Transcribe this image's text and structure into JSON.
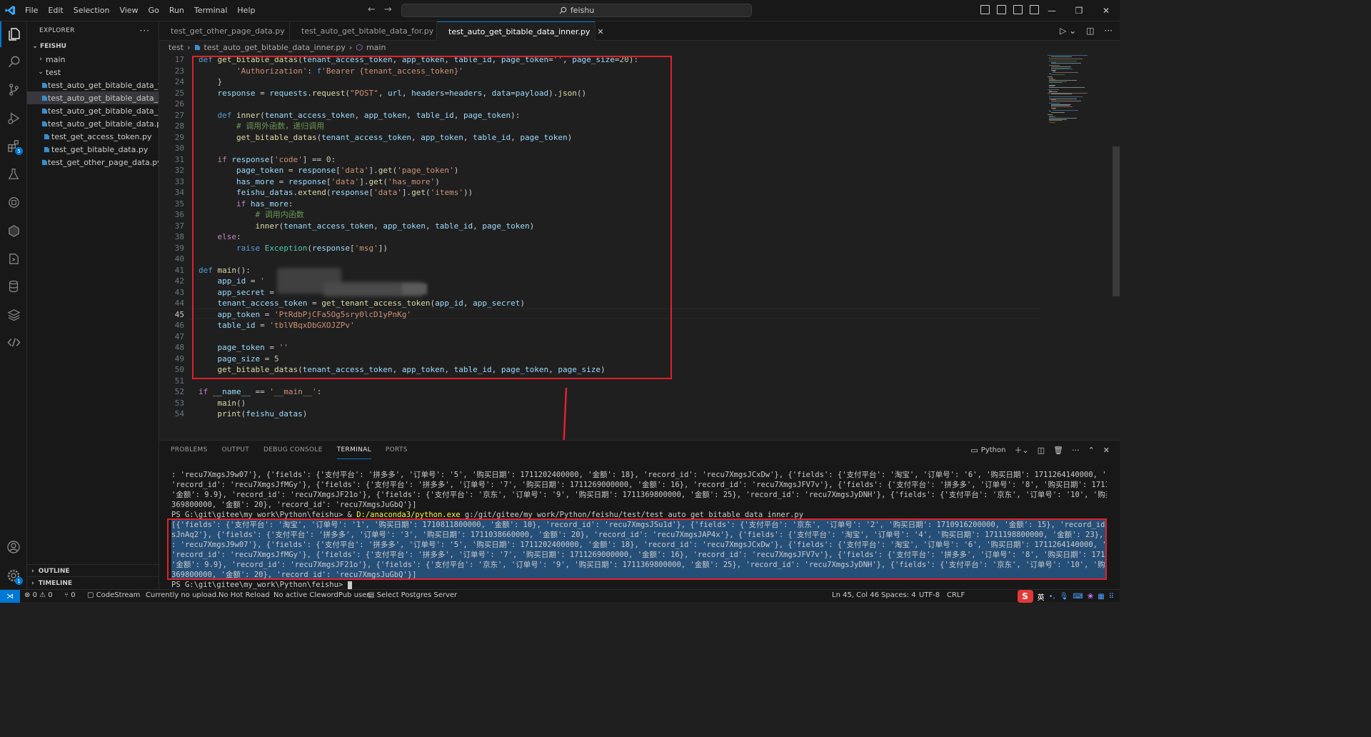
{
  "menu": [
    "File",
    "Edit",
    "Selection",
    "View",
    "Go",
    "Run",
    "Terminal",
    "Help"
  ],
  "search": {
    "text": "feishu"
  },
  "sidebar": {
    "title": "EXPLORER",
    "root": "FEISHU",
    "folders": [
      "main",
      "test"
    ],
    "files": [
      "test_auto_get_bitable_data_fo...",
      "test_auto_get_bitable_data_in...",
      "test_auto_get_bitable_data_w...",
      "test_auto_get_bitable_data.py",
      "test_get_access_token.py",
      "test_get_bitable_data.py",
      "test_get_other_page_data.py"
    ],
    "outline": "OUTLINE",
    "timeline": "TIMELINE"
  },
  "activity_badges": {
    "extensions": "5",
    "settings": "1"
  },
  "tabs": [
    {
      "label": "test_get_other_page_data.py"
    },
    {
      "label": "test_auto_get_bitable_data_for.py"
    },
    {
      "label": "test_auto_get_bitable_data_inner.py"
    }
  ],
  "breadcrumb": {
    "folder": "test",
    "file": "test_auto_get_bitable_data_inner.py",
    "symbol": "main"
  },
  "code": [
    {
      "n": "17",
      "t": "def get_bitable_datas(tenant_access_token, app_token, table_id, page_token='', page_size=20):"
    },
    {
      "n": "23",
      "t": "        'Authorization': f'Bearer {tenant_access_token}'"
    },
    {
      "n": "24",
      "t": "    }"
    },
    {
      "n": "25",
      "t": "    response = requests.request(\"POST\", url, headers=headers, data=payload).json()"
    },
    {
      "n": "26",
      "t": ""
    },
    {
      "n": "27",
      "t": "    def inner(tenant_access_token, app_token, table_id, page_token):"
    },
    {
      "n": "28",
      "t": "        # 调用外函数，递归调用"
    },
    {
      "n": "29",
      "t": "        get_bitable_datas(tenant_access_token, app_token, table_id, page_token)"
    },
    {
      "n": "30",
      "t": ""
    },
    {
      "n": "31",
      "t": "    if response['code'] == 0:"
    },
    {
      "n": "32",
      "t": "        page_token = response['data'].get('page_token')"
    },
    {
      "n": "33",
      "t": "        has_more = response['data'].get('has_more')"
    },
    {
      "n": "34",
      "t": "        feishu_datas.extend(response['data'].get('items'))"
    },
    {
      "n": "35",
      "t": "        if has_more:"
    },
    {
      "n": "36",
      "t": "            # 调用内函数"
    },
    {
      "n": "37",
      "t": "            inner(tenant_access_token, app_token, table_id, page_token)"
    },
    {
      "n": "38",
      "t": "    else:"
    },
    {
      "n": "39",
      "t": "        raise Exception(response['msg'])"
    },
    {
      "n": "40",
      "t": ""
    },
    {
      "n": "41",
      "t": "def main():"
    },
    {
      "n": "42",
      "t": "    app_id = '"
    },
    {
      "n": "43",
      "t": "    app_secret = '"
    },
    {
      "n": "44",
      "t": "    tenant_access_token = get_tenant_access_token(app_id, app_secret)"
    },
    {
      "n": "45",
      "t": "    app_token = 'PtRdbPjCFa5Og5sry0lcD1yPnKg'"
    },
    {
      "n": "46",
      "t": "    table_id = 'tblVBqxDbGXOJZPv'"
    },
    {
      "n": "47",
      "t": ""
    },
    {
      "n": "48",
      "t": "    page_token = ''"
    },
    {
      "n": "49",
      "t": "    page_size = 5"
    },
    {
      "n": "50",
      "t": "    get_bitable_datas(tenant_access_token, app_token, table_id, page_token, page_size)"
    },
    {
      "n": "51",
      "t": ""
    },
    {
      "n": "52",
      "t": "if __name__ == '__main__':"
    },
    {
      "n": "53",
      "t": "    main()"
    },
    {
      "n": "54",
      "t": "    print(feishu_datas)"
    }
  ],
  "panel": {
    "tabs": [
      "PROBLEMS",
      "OUTPUT",
      "DEBUG CONSOLE",
      "TERMINAL",
      "PORTS"
    ],
    "shell": "Python"
  },
  "terminal": [
    ": 'recu7XmgsJ9w07'}, {'fields': {'支付平台': '拼多多', '订单号': '5', '购买日期': 1711202400000, '金额': 18}, 'record_id': 'recu7XmgsJCxDw'}, {'fields': {'支付平台': '淘宝', '订单号': '6', '购买日期': 1711264140000, '金额': 20},",
    "'record_id': 'recu7XmgsJfMGy'}, {'fields': {'支付平台': '拼多多', '订单号': '7', '购买日期': 1711269000000, '金额': 16}, 'record_id': 'recu7XmgsJFV7v'}, {'fields': {'支付平台': '拼多多', '订单号': '8', '购买日期': 1711362600000,",
    "'金额': 9.9}, 'record_id': 'recu7XmgsJF21o'}, {'fields': {'支付平台': '京东', '订单号': '9', '购买日期': 1711369800000, '金额': 25}, 'record_id': 'recu7XmgsJyDNH'}, {'fields': {'支付平台': '京东', '订单号': '10', '购买日期': 1711",
    "369800000, '金额': 20}, 'record_id': 'recu7XmgsJuGbQ'}]",
    "PS G:\\git\\gitee\\my_work\\Python\\feishu> & D:/anaconda3/python.exe g:/git/gitee/my_work/Python/feishu/test/test_auto_get_bitable_data_inner.py",
    "[{'fields': {'支付平台': '淘宝', '订单号': '1', '购买日期': 1710811800000, '金额': 10}, 'record_id': 'recu7XmgsJSu1d'}, {'fields': {'支付平台': '京东', '订单号': '2', '购买日期': 1710916200000, '金额': 15}, 'record_id': 'recu7Xmg",
    "sJnAq2'}, {'fields': {'支付平台': '拼多多', '订单号': '3', '购买日期': 1711038660000, '金额': 20}, 'record_id': 'recu7XmgsJAP4x'}, {'fields': {'支付平台': '淘宝', '订单号': '4', '购买日期': 1711198800000, '金额': 23}, 'record_id'",
    ": 'recu7XmgsJ9w07'}, {'fields': {'支付平台': '拼多多', '订单号': '5', '购买日期': 1711202400000, '金额': 18}, 'record_id': 'recu7XmgsJCxDw'}, {'fields': {'支付平台': '淘宝', '订单号': '6', '购买日期': 1711264140000, '金额': 20},",
    "'record_id': 'recu7XmgsJfMGy'}, {'fields': {'支付平台': '拼多多', '订单号': '7', '购买日期': 1711269000000, '金额': 16}, 'record_id': 'recu7XmgsJFV7v'}, {'fields': {'支付平台': '拼多多', '订单号': '8', '购买日期': 1711362600000,",
    "'金额': 9.9}, 'record_id': 'recu7XmgsJF21o'}, {'fields': {'支付平台': '京东', '订单号': '9', '购买日期': 1711369800000, '金额': 25}, 'record_id': 'recu7XmgsJyDNH'}, {'fields': {'支付平台': '京东', '订单号': '10', '购买日期': 1711",
    "369800000, '金额': 20}, 'record_id': 'recu7XmgsJuGbQ'}]",
    "PS G:\\git\\gitee\\my_work\\Python\\feishu> "
  ],
  "status": {
    "errors": "0",
    "warnings": "0",
    "ports": "0",
    "codestream": "CodeStream",
    "upload": "Currently no upload.",
    "reload": "No Hot Reload",
    "clewordpub": "No active ClewordPub user.",
    "postgres": "Select Postgres Server",
    "position": "Ln 45, Col 46",
    "spaces": "Spaces: 4",
    "encoding": "UTF-8",
    "eol": "CRLF",
    "ime_lang": "英"
  },
  "colors": {
    "accent": "#0078d4",
    "annotation": "#e0212a",
    "selection": "#264f78"
  }
}
